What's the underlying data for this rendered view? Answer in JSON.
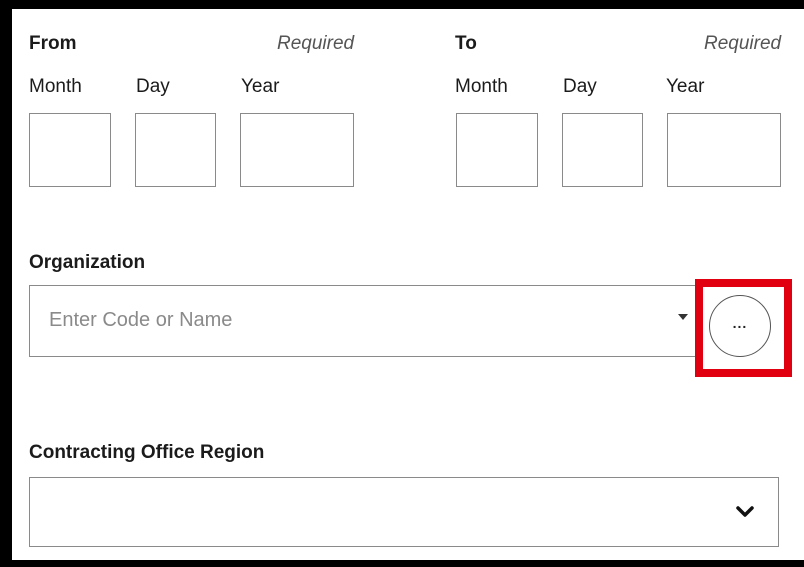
{
  "date_range": {
    "from": {
      "label": "From",
      "required_text": "Required",
      "month_label": "Month",
      "day_label": "Day",
      "year_label": "Year",
      "month_value": "",
      "day_value": "",
      "year_value": ""
    },
    "to": {
      "label": "To",
      "required_text": "Required",
      "month_label": "Month",
      "day_label": "Day",
      "year_label": "Year",
      "month_value": "",
      "day_value": "",
      "year_value": ""
    }
  },
  "organization": {
    "label": "Organization",
    "placeholder": "Enter Code or Name",
    "value": "",
    "dropdown_icon": "caret-down-icon",
    "more_button_icon": "ellipsis-icon",
    "more_button_text": "...",
    "highlight_color": "#e0000f"
  },
  "contracting_office_region": {
    "label": "Contracting Office Region",
    "selected_value": "",
    "dropdown_icon": "chevron-down-icon"
  }
}
